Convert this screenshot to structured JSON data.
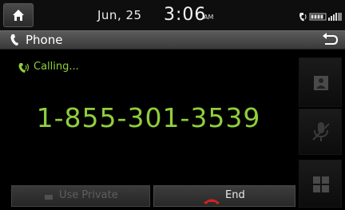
{
  "status_bar": {
    "date": "Jun, 25",
    "time": "3:06",
    "ampm": "AM"
  },
  "title_bar": {
    "title": "Phone"
  },
  "call": {
    "status": "Calling...",
    "number": "1-855-301-3539"
  },
  "bottom_buttons": {
    "use_private": "Use Private",
    "end": "End"
  },
  "colors": {
    "accent_green": "#8fcf3c",
    "end_red": "#d42020"
  },
  "icons": {
    "home": "home-icon",
    "phone": "phone-icon",
    "back": "back-arrow-icon",
    "contacts": "contacts-icon",
    "mic": "microphone-icon",
    "keypad": "keypad-icon",
    "end_call": "end-call-icon"
  }
}
